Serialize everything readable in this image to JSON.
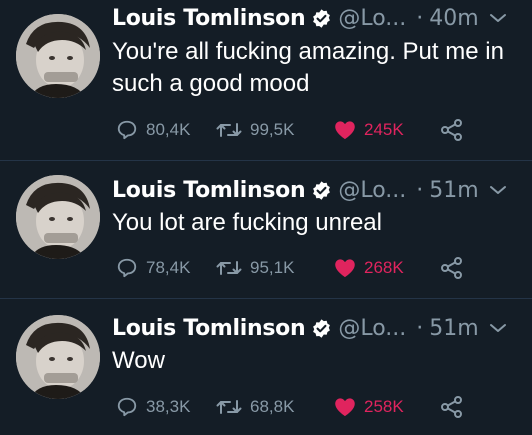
{
  "colors": {
    "background": "#141d26",
    "divider": "#243447",
    "muted": "#8899a6",
    "like": "#e0245e",
    "verified_badge": "#ffffff"
  },
  "tweets": [
    {
      "author": "Louis Tomlinson",
      "handle": "@Lo...",
      "separator": "·",
      "time": "40m",
      "text": "You're all fucking amazing. Put me in such a good mood",
      "replies": "80,4K",
      "retweets": "99,5K",
      "likes": "245K",
      "liked": true
    },
    {
      "author": "Louis Tomlinson",
      "handle": "@Lo...",
      "separator": "·",
      "time": "51m",
      "text": "You lot are fucking unreal",
      "replies": "78,4K",
      "retweets": "95,1K",
      "likes": "268K",
      "liked": true
    },
    {
      "author": "Louis Tomlinson",
      "handle": "@Lo...",
      "separator": "·",
      "time": "51m",
      "text": "Wow",
      "replies": "38,3K",
      "retweets": "68,8K",
      "likes": "258K",
      "liked": true
    }
  ],
  "icons": {
    "reply": "reply-icon",
    "retweet": "retweet-icon",
    "like": "heart-icon",
    "share": "share-icon",
    "verified": "verified-badge-icon",
    "menu": "chevron-down-icon"
  }
}
